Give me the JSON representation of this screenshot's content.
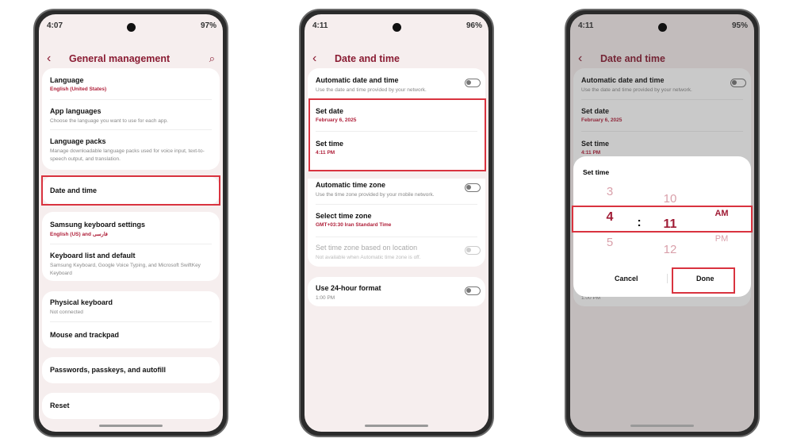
{
  "phone1": {
    "status": {
      "time": "4:07",
      "battery": "97%"
    },
    "title": "General management",
    "items": [
      {
        "title": "Language",
        "subtitle": "English (United States)"
      },
      {
        "title": "App languages",
        "subtitle": "Choose the language you want to use for each app."
      },
      {
        "title": "Language packs",
        "subtitle": "Manage downloadable language packs used for voice input, text-to-speech output, and translation."
      },
      {
        "title": "Date and time"
      },
      {
        "title": "Samsung keyboard settings",
        "subtitle": "English (US) and فارسی"
      },
      {
        "title": "Keyboard list and default",
        "subtitle": "Samsung Keyboard, Google Voice Typing, and Microsoft SwiftKey Keyboard"
      },
      {
        "title": "Physical keyboard",
        "subtitle": "Not connected"
      },
      {
        "title": "Mouse and trackpad"
      },
      {
        "title": "Passwords, passkeys, and autofill"
      },
      {
        "title": "Reset"
      }
    ]
  },
  "phone2": {
    "status": {
      "time": "4:11",
      "battery": "96%"
    },
    "title": "Date and time",
    "items": [
      {
        "title": "Automatic date and time",
        "subtitle": "Use the date and time provided by your network.",
        "toggle": false
      },
      {
        "title": "Set date",
        "subtitle": "February 6, 2025"
      },
      {
        "title": "Set time",
        "subtitle": "4:11 PM"
      },
      {
        "title": "Automatic time zone",
        "subtitle": "Use the time zone provided by your mobile network.",
        "toggle": false
      },
      {
        "title": "Select time zone",
        "subtitle": "GMT+03:30 Iran Standard Time"
      },
      {
        "title": "Set time zone based on location",
        "subtitle": "Not available when Automatic time zone is off.",
        "toggle": false,
        "disabled": true
      },
      {
        "title": "Use 24-hour format",
        "subtitle": "1:00 PM",
        "toggle": false
      }
    ]
  },
  "phone3": {
    "status": {
      "time": "4:11",
      "battery": "95%"
    },
    "title": "Date and time",
    "items": [
      {
        "title": "Automatic date and time",
        "subtitle": "Use the date and time provided by your network."
      },
      {
        "title": "Set date",
        "subtitle": "February 6, 2025"
      },
      {
        "title": "Set time",
        "subtitle": "4:11 PM"
      },
      {
        "subtitle": "1:00 PM"
      }
    ],
    "dialog": {
      "title": "Set time",
      "hours": [
        "3",
        "4",
        "5"
      ],
      "minutes": [
        "10",
        "11",
        "12"
      ],
      "ampm": [
        "AM",
        "PM"
      ],
      "separator": ":",
      "cancel": "Cancel",
      "done": "Done"
    }
  },
  "colors": {
    "accent": "#8a1c33",
    "highlight": "#d9333f"
  }
}
